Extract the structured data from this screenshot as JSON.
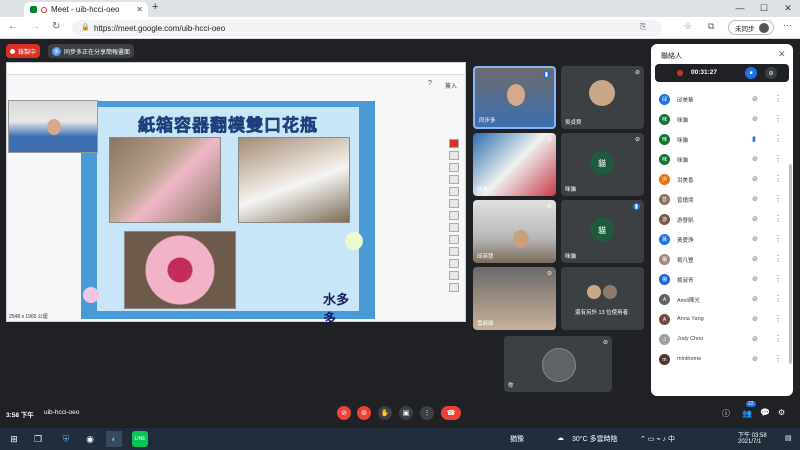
{
  "browser": {
    "tab_title": "Meet - uib-hcci-oeo",
    "new_tab": "+",
    "url": "https://meet.google.com/uib-hcci-oeo",
    "sync_button": "未同步",
    "minimize": "—",
    "maximize": "☐",
    "close": "✕"
  },
  "meet": {
    "recording_badge": "錄製中",
    "presenter_badge": "同步多正在分享簡報畫面",
    "presenter_initial": "多",
    "slide": {
      "title": "紙箱容器翻模雙口花瓶",
      "logo": "水多多",
      "status": "2548 x 1965 公厘",
      "header_label": "簽入"
    },
    "meeting_time": "3:58 下午",
    "meeting_code": "uib-hcci-oeo",
    "participants_count": "22"
  },
  "tiles": [
    {
      "name": "同步多",
      "mic": "speaking"
    },
    {
      "name": "吳貞齊",
      "mic": "muted"
    },
    {
      "name": "咪貓",
      "mic": "muted"
    },
    {
      "name": "咪貓",
      "mic": "muted",
      "avatar": "貓"
    },
    {
      "name": "邱英慧",
      "mic": "muted"
    },
    {
      "name": "咪貓",
      "mic": "speaking",
      "avatar": "貓"
    },
    {
      "name": "雲爺爺",
      "mic": "muted"
    },
    {
      "name": "還有另外 13 位使用者",
      "mic": ""
    },
    {
      "name": "你",
      "mic": "muted"
    }
  ],
  "panel": {
    "title": "聯絡人",
    "rec_time": "00:31:27",
    "people": [
      {
        "name": "邱美華",
        "initial": "邱",
        "color": "#1a73e8"
      },
      {
        "name": "咪貓",
        "initial": "咪",
        "color": "#137333"
      },
      {
        "name": "咪貓",
        "initial": "咪",
        "color": "#137333"
      },
      {
        "name": "咪貓",
        "initial": "咪",
        "color": "#137333"
      },
      {
        "name": "洪美香",
        "initial": "洪",
        "color": "#e8710a"
      },
      {
        "name": "曾鐿境",
        "initial": "曾",
        "color": "#8d6e63"
      },
      {
        "name": "游晉凱",
        "initial": "游",
        "color": "#795548"
      },
      {
        "name": "黃愛琤",
        "initial": "黃",
        "color": "#1a73e8"
      },
      {
        "name": "楊凡豐",
        "initial": "楊",
        "color": "#a1887f"
      },
      {
        "name": "楊淑青",
        "initial": "楊",
        "color": "#1967d2"
      },
      {
        "name": "Amili陳光",
        "initial": "A",
        "color": "#5f6368"
      },
      {
        "name": "Anna Yang",
        "initial": "A",
        "color": "#6d4c41"
      },
      {
        "name": "Judy Chou",
        "initial": "J",
        "color": "#9e9e9e"
      },
      {
        "name": "minthome",
        "initial": "m",
        "color": "#4e342e"
      }
    ]
  },
  "taskbar": {
    "weather": "30°C 多雲時陰",
    "tray_label": "猶豫",
    "time": "下午 03:58",
    "date": "2021/7/1"
  }
}
